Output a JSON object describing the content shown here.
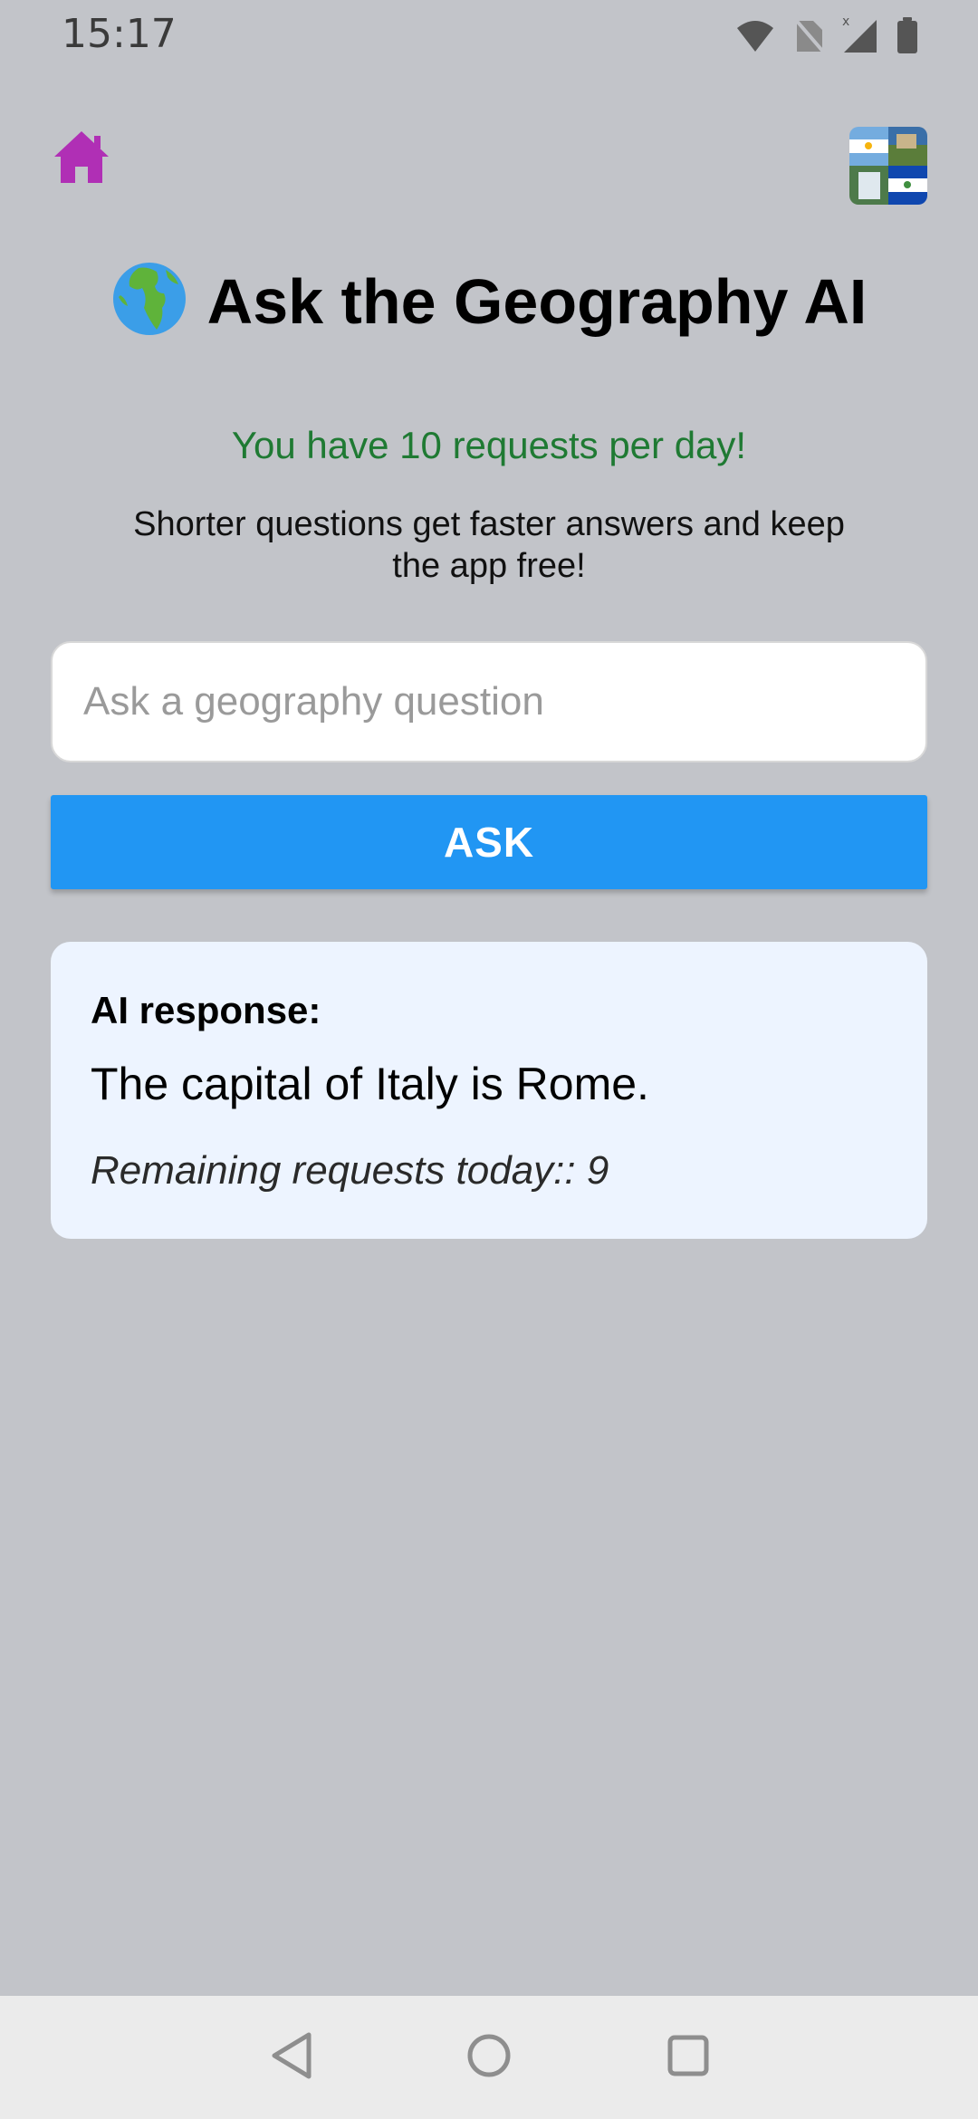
{
  "status_bar": {
    "time": "15:17",
    "icons": [
      "wifi-icon",
      "no-sim-icon",
      "signal-icon",
      "battery-icon"
    ]
  },
  "header": {
    "home_icon": "home-icon",
    "avatar_icon": "flags-collage-avatar",
    "title": "Ask the Geography AI",
    "title_emoji_icon": "globe-africa-europe-icon"
  },
  "intro": {
    "requests_note": "You have 10 requests per day!",
    "hint": "Shorter questions get faster answers and keep the app free!"
  },
  "form": {
    "input_value": "",
    "input_placeholder": "Ask a geography question",
    "ask_label": "ASK"
  },
  "response": {
    "heading": "AI response:",
    "answer": "The capital of Italy is Rome.",
    "remaining": "Remaining requests today:: 9"
  },
  "colors": {
    "background": "#c2c4c9",
    "accent_button": "#2196f3",
    "home_icon": "#b02fb5",
    "note_green": "#1f7a33",
    "response_card": "#edf4ff"
  },
  "nav_bar": {
    "icons": [
      "back-icon",
      "home-circle-icon",
      "recents-icon"
    ]
  }
}
